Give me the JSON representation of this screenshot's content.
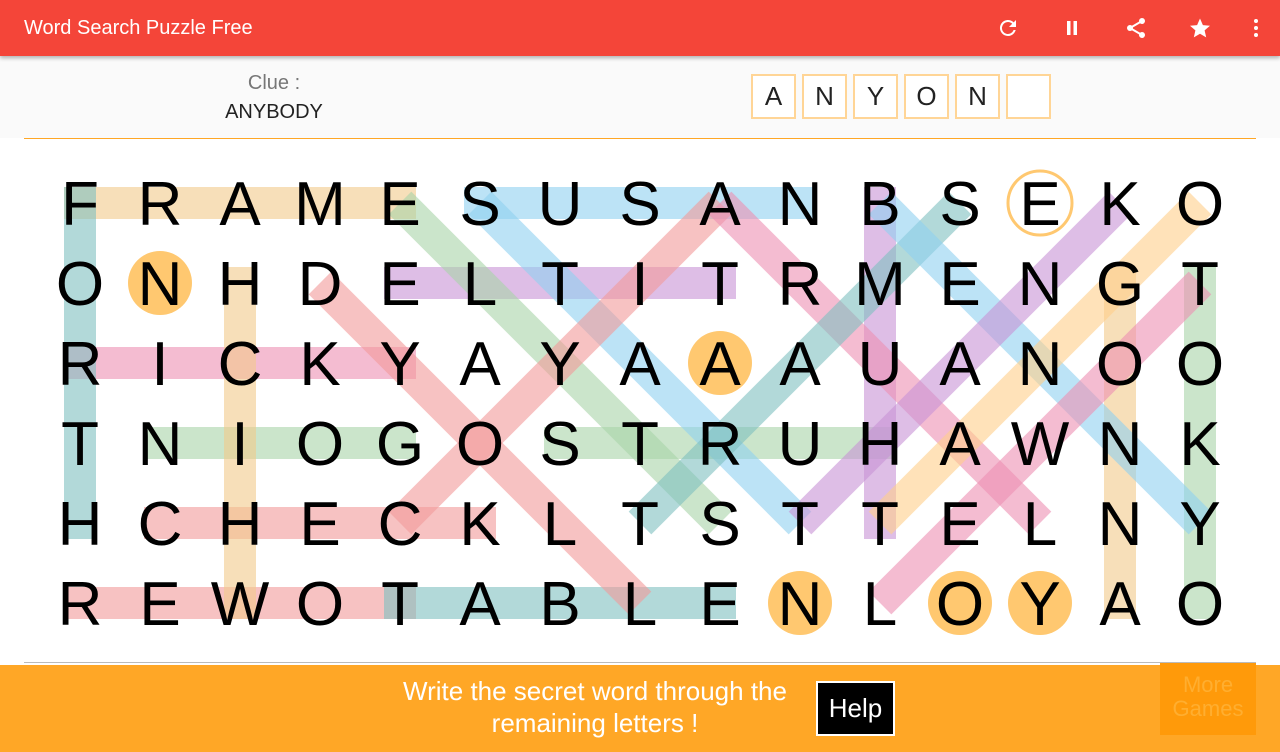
{
  "app": {
    "title": "Word Search Puzzle Free"
  },
  "toolbar": {
    "icons": [
      "refresh-icon",
      "pause-icon",
      "share-icon",
      "star-icon",
      "more-vert-icon"
    ]
  },
  "clue": {
    "label": "Clue :",
    "value": "ANYBODY",
    "answer_slots": [
      "A",
      "N",
      "Y",
      "O",
      "N",
      ""
    ]
  },
  "grid": {
    "rows": [
      "FRAMESUSANBSEKO",
      "ONHDELTITRMENGT",
      "RICKYAYAAAUANOO",
      "TNIOGOSTRUHAWNK",
      "HCHECKLTSTTELNY",
      "REWOTABLENLOYAO"
    ]
  },
  "footer": {
    "message_line1": "Write the secret word through the",
    "message_line2": "remaining letters !",
    "help_label": "Help",
    "more_line1": "More",
    "more_line2": "Games"
  },
  "colors": {
    "appbar": "#f44539",
    "accent": "#ffa726",
    "circle": "#ffc870"
  }
}
